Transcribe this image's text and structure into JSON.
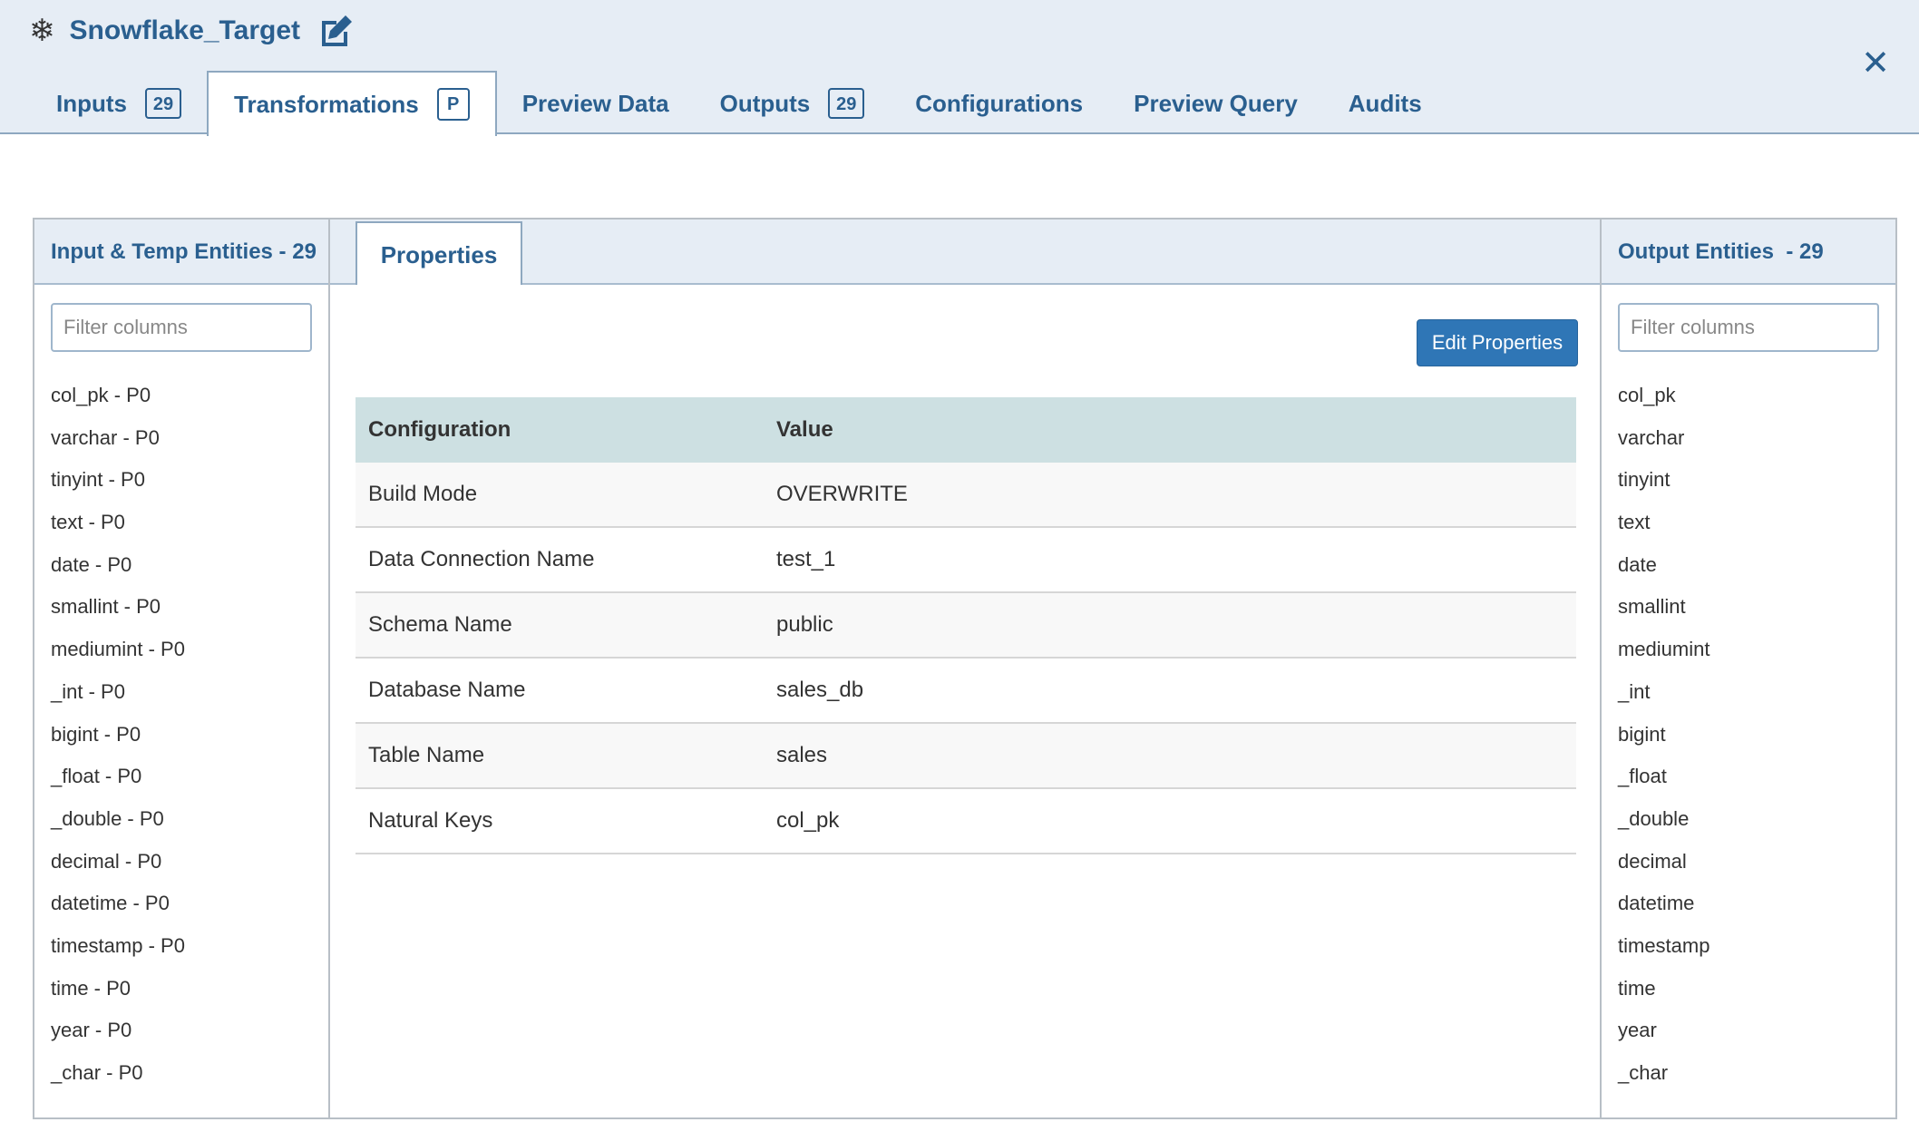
{
  "header": {
    "title": "Snowflake_Target",
    "close_label": "✕"
  },
  "tabs": [
    {
      "label": "Inputs",
      "badge": "29",
      "active": false
    },
    {
      "label": "Transformations",
      "badge": "P",
      "active": true
    },
    {
      "label": "Preview Data",
      "active": false
    },
    {
      "label": "Outputs",
      "badge": "29",
      "active": false
    },
    {
      "label": "Configurations",
      "active": false
    },
    {
      "label": "Preview Query",
      "active": false
    },
    {
      "label": "Audits",
      "active": false
    }
  ],
  "left_panel": {
    "title": "Input & Temp Entities - 29",
    "filter_placeholder": "Filter columns",
    "columns": [
      "col_pk - P0",
      "varchar - P0",
      "tinyint - P0",
      "text - P0",
      "date - P0",
      "smallint - P0",
      "mediumint - P0",
      "_int - P0",
      "bigint - P0",
      "_float - P0",
      "_double - P0",
      "decimal - P0",
      "datetime - P0",
      "timestamp - P0",
      "time - P0",
      "year - P0",
      "_char - P0"
    ]
  },
  "middle": {
    "tab_label": "Properties",
    "edit_button": "Edit Properties",
    "table": {
      "headers": [
        "Configuration",
        "Value"
      ],
      "rows": [
        [
          "Build Mode",
          "OVERWRITE"
        ],
        [
          "Data Connection Name",
          "test_1"
        ],
        [
          "Schema Name",
          "public"
        ],
        [
          "Database Name",
          "sales_db"
        ],
        [
          "Table Name",
          "sales"
        ],
        [
          "Natural Keys",
          "col_pk"
        ]
      ]
    }
  },
  "right_panel": {
    "title": "Output Entities  - 29",
    "filter_placeholder": "Filter columns",
    "columns": [
      "col_pk",
      "varchar",
      "tinyint",
      "text",
      "date",
      "smallint",
      "mediumint",
      "_int",
      "bigint",
      "_float",
      "_double",
      "decimal",
      "datetime",
      "timestamp",
      "time",
      "year",
      "_char"
    ]
  },
  "colors": {
    "accent": "#2a5f8f",
    "header_bg": "#e6edf5",
    "button": "#2f76b6",
    "table_head": "#cde0e2"
  }
}
